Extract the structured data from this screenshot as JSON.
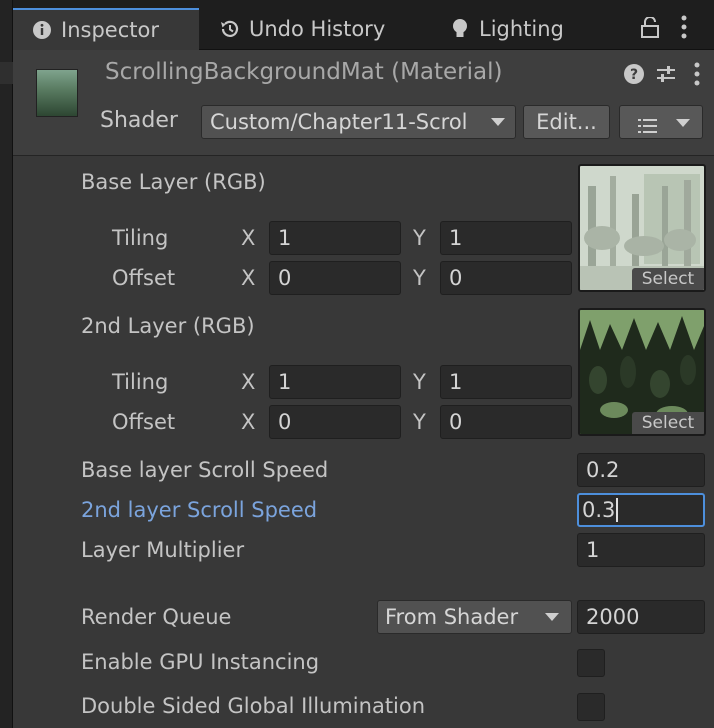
{
  "tabs": [
    {
      "label": "Inspector",
      "icon": "info-icon",
      "active": true
    },
    {
      "label": "Undo History",
      "icon": "history-icon",
      "active": false
    },
    {
      "label": "Lighting",
      "icon": "lightbulb-icon",
      "active": false
    }
  ],
  "header": {
    "title": "ScrollingBackgroundMat (Material)",
    "shader_label": "Shader",
    "shader_value": "Custom/Chapter11-Scrol",
    "edit_label": "Edit...",
    "icons": [
      "help-icon",
      "preset-icon",
      "more-icon"
    ]
  },
  "layers": [
    {
      "title": "Base Layer (RGB)",
      "tiling_label": "Tiling",
      "offset_label": "Offset",
      "tiling": {
        "x": "1",
        "y": "1"
      },
      "offset": {
        "x": "0",
        "y": "0"
      },
      "select_label": "Select"
    },
    {
      "title": "2nd Layer (RGB)",
      "tiling_label": "Tiling",
      "offset_label": "Offset",
      "tiling": {
        "x": "1",
        "y": "1"
      },
      "offset": {
        "x": "0",
        "y": "0"
      },
      "select_label": "Select"
    }
  ],
  "axis": {
    "x": "X",
    "y": "Y"
  },
  "properties": [
    {
      "label": "Base layer Scroll Speed",
      "value": "0.2",
      "focused": false
    },
    {
      "label": "2nd layer Scroll Speed",
      "value": "0.3",
      "focused": true
    },
    {
      "label": "Layer Multiplier",
      "value": "1",
      "focused": false
    }
  ],
  "render_queue": {
    "label": "Render Queue",
    "mode": "From Shader",
    "value": "2000"
  },
  "toggles": [
    {
      "label": "Enable GPU Instancing",
      "checked": false
    },
    {
      "label": "Double Sided Global Illumination",
      "checked": false
    }
  ],
  "colors": {
    "accent": "#4d8fdc",
    "highlight_label": "#7ba4dd",
    "panel": "#383838"
  }
}
